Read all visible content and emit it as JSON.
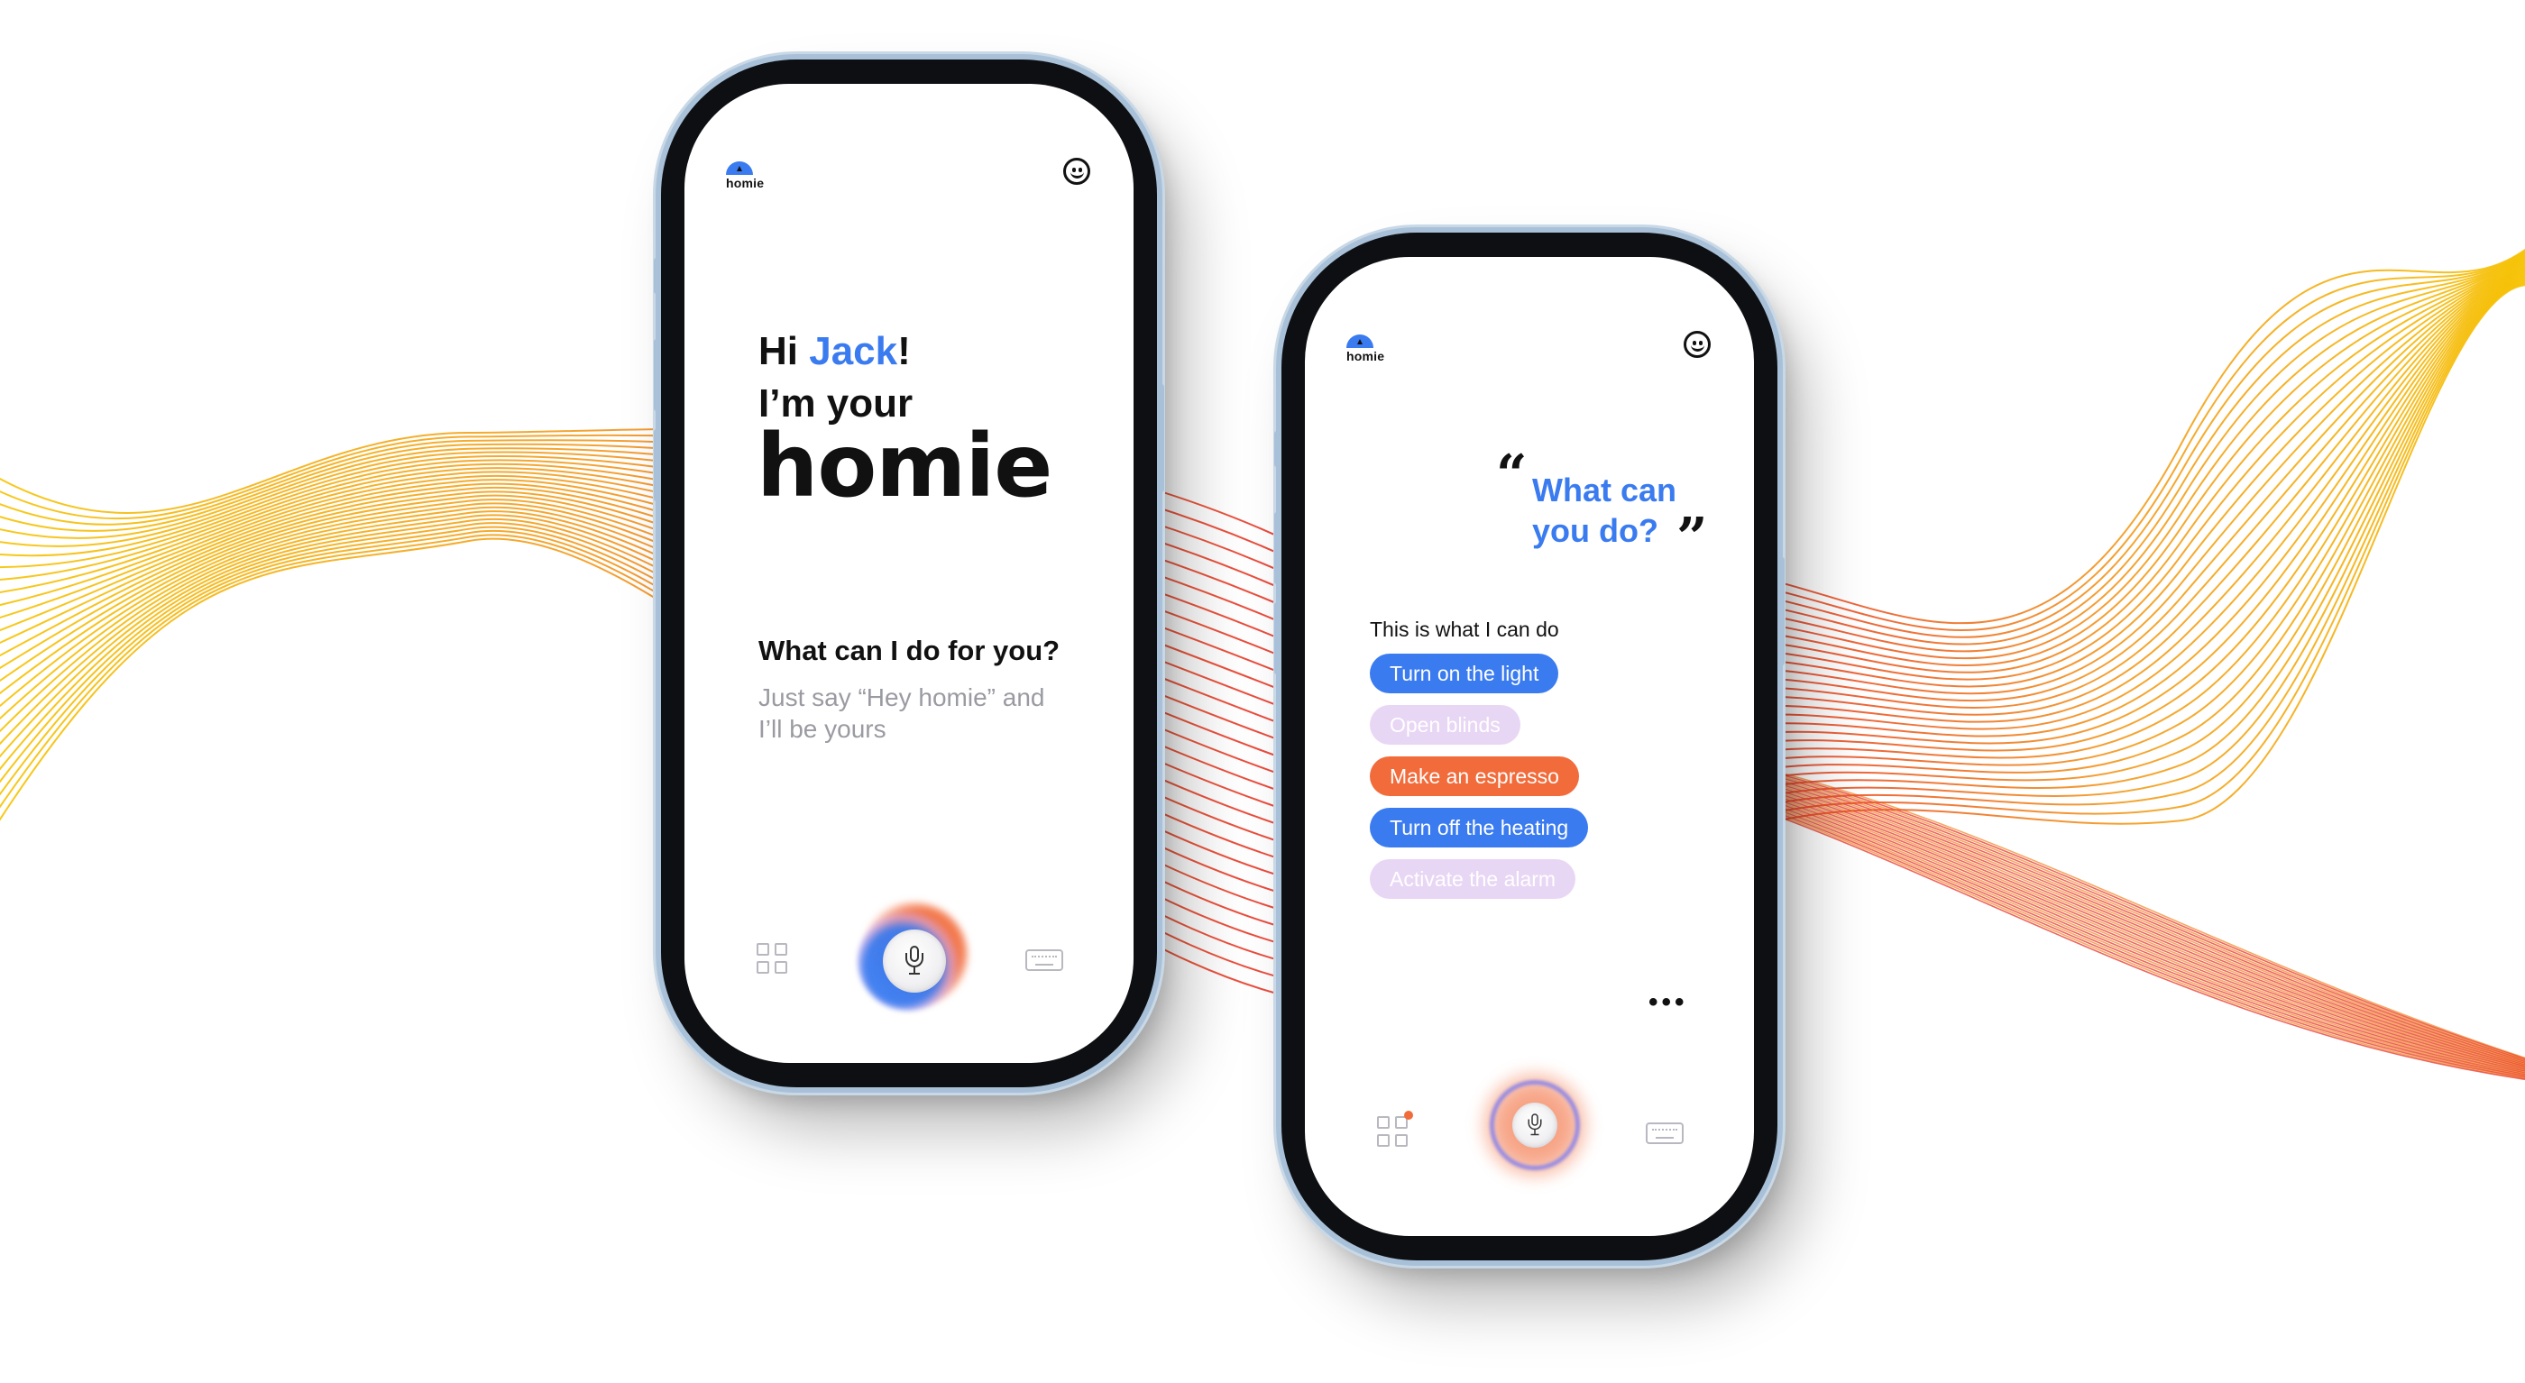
{
  "brand": {
    "logo_text": "homie",
    "accent": "#3a7bf0",
    "orange": "#f26b3a",
    "lavender": "#e8d6f5"
  },
  "screen1": {
    "greeting_hi": "Hi ",
    "user_name": "Jack",
    "greeting_bang": "!",
    "greeting_line2": "I’m your",
    "headline": "homie",
    "prompt_title": "What can I do for you?",
    "prompt_sub": "Just say “Hey homie” and I’ll be yours",
    "icons": [
      "grid-icon",
      "mic-icon",
      "keyboard-icon",
      "smiley-icon"
    ]
  },
  "screen2": {
    "quote_open": "“",
    "question": "What can you do?",
    "quote_close": "”",
    "can_do_label": "This is what I can do",
    "chips": [
      {
        "label": "Turn on the light",
        "color": "blue"
      },
      {
        "label": "Open blinds",
        "color": "lavender"
      },
      {
        "label": "Make an espresso",
        "color": "orange"
      },
      {
        "label": "Turn off the heating",
        "color": "blue"
      },
      {
        "label": "Activate the alarm",
        "color": "lavender"
      }
    ],
    "typing_indicator": "•••",
    "icons": [
      "grid-icon",
      "mic-icon",
      "keyboard-icon",
      "smiley-icon"
    ]
  }
}
